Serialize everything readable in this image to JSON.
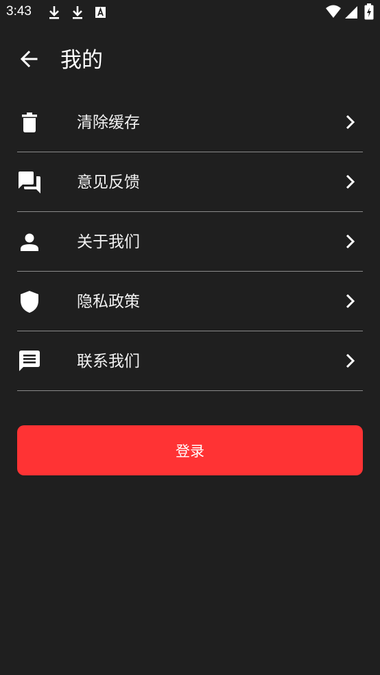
{
  "status_bar": {
    "time": "3:43",
    "icons": [
      "download-icon",
      "download-icon",
      "accessibility-a-icon",
      "wifi-icon",
      "cell-signal-icon",
      "battery-charging-icon"
    ]
  },
  "app_bar": {
    "title": "我的",
    "back_icon": "arrow-back-icon"
  },
  "menu": {
    "items": [
      {
        "label": "清除缓存",
        "icon": "trash-icon"
      },
      {
        "label": "意见反馈",
        "icon": "forum-icon"
      },
      {
        "label": "关于我们",
        "icon": "person-icon"
      },
      {
        "label": "隐私政策",
        "icon": "shield-icon"
      },
      {
        "label": "联系我们",
        "icon": "chat-icon"
      }
    ],
    "chevron_icon": "chevron-right-icon"
  },
  "login_button": {
    "label": "登录",
    "color": "#ff3334"
  },
  "colors": {
    "background": "#1f1f1f",
    "divider": "#8a8a8a",
    "text": "#ffffff"
  }
}
